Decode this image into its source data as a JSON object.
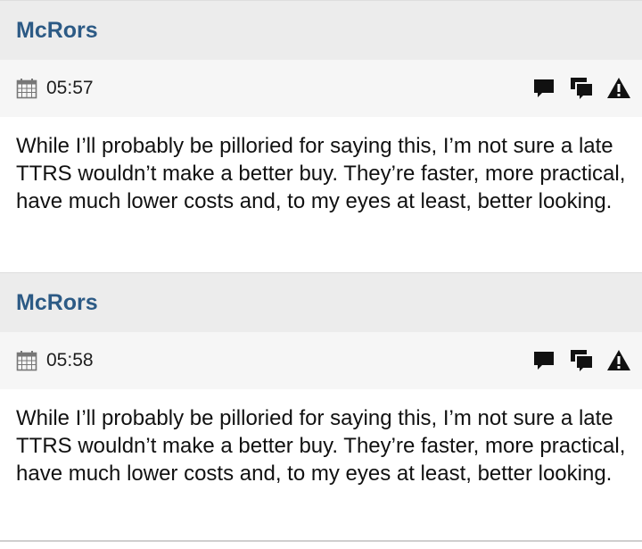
{
  "posts": [
    {
      "username": "McRors",
      "time": "05:57",
      "text": "While I’ll probably be pilloried for saying this, I’m not sure a late TTRS wouldn’t make a better buy. They’re faster, more practical, have much lower costs and, to my eyes at least, better looking.",
      "icons": {
        "date": "calendar-icon",
        "reply": "comment-icon",
        "quote": "multi-quote-icon",
        "report": "warning-icon"
      }
    },
    {
      "username": "McRors",
      "time": "05:58",
      "text": "While I’ll probably be pilloried for saying this, I’m not sure a late TTRS wouldn’t make a better buy. They’re faster, more practical, have much lower costs and, to my eyes at least, better looking.",
      "icons": {
        "date": "calendar-icon",
        "reply": "comment-icon",
        "quote": "multi-quote-icon",
        "report": "warning-icon"
      }
    }
  ],
  "colors": {
    "username": "#2c5a85",
    "header_bg": "#ececec",
    "meta_bg": "#f6f6f6",
    "icon": "#111111"
  }
}
